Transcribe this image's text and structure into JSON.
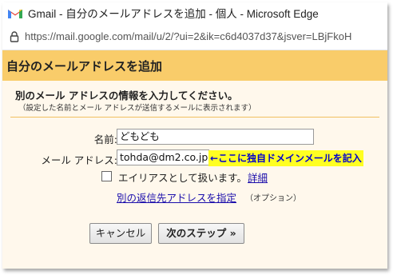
{
  "window": {
    "title": "Gmail - 自分のメールアドレスを追加 - 個人 - Microsoft Edge",
    "url": "https://mail.google.com/mail/u/2/?ui=2&ik=c6d4037d37&jsver=LBjFkoH"
  },
  "dialog": {
    "title": "自分のメールアドレスを追加",
    "section_title": "別のメール アドレスの情報を入力してください。",
    "section_note": "（設定した名前とメール アドレスが送信するメールに表示されます）"
  },
  "form": {
    "name_label": "名前:",
    "name_value": "どもども",
    "email_label": "メール アドレス:",
    "email_value": "tohda@dm2.co.jp",
    "annotation": "←ここに独自ドメインメールを記入",
    "alias_label": "エイリアスとして扱います。",
    "alias_checked": false,
    "alias_link": "詳細",
    "reply_to_link": "別の返信先アドレスを指定",
    "reply_to_note": "（オプション）"
  },
  "buttons": {
    "cancel": "キャンセル",
    "next": "次のステップ »"
  },
  "colors": {
    "header_bg": "#f9cc6a",
    "dialog_bg": "#fff8ec",
    "link": "#1a0dab",
    "annotation_bg": "#ffff22",
    "annotation_text": "#0000cc"
  }
}
